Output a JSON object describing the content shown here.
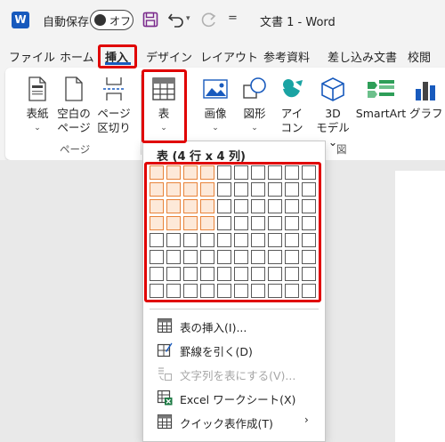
{
  "titlebar": {
    "autosave_label": "自動保存",
    "toggle_state": "オフ",
    "document_title": "文書 1  -  Word",
    "word_logo": "W",
    "qat_customize": "="
  },
  "tabs": [
    "ファイル",
    "ホーム",
    "挿入",
    "デザイン",
    "レイアウト",
    "参考資料",
    "差し込み文書",
    "校閲"
  ],
  "ribbon": {
    "cover": [
      "表紙",
      "⌄"
    ],
    "blank_page": [
      "空白の",
      "ページ"
    ],
    "page_break": [
      "ページ",
      "区切り"
    ],
    "table": [
      "表",
      "⌄"
    ],
    "picture": [
      "画像",
      "⌄"
    ],
    "shapes": [
      "図形",
      "⌄"
    ],
    "icons": [
      "アイ",
      "コン"
    ],
    "model3d": [
      "3D",
      "モデル ⌄"
    ],
    "smartart": "SmartArt",
    "chart": "グラフ",
    "group_pages": "ページ",
    "group_illustrations": "図"
  },
  "table_menu": {
    "header": "表 (4 行 x 4 列)",
    "grid_columns": 10,
    "grid_rows": 8,
    "selected_rows": 4,
    "selected_cols": 4,
    "items": [
      {
        "label": "表の挿入(I)...",
        "disabled": false
      },
      {
        "label": "罫線を引く(D)",
        "disabled": false
      },
      {
        "label": "文字列を表にする(V)...",
        "disabled": true
      },
      {
        "label": "Excel ワークシート(X)",
        "disabled": false
      },
      {
        "label": "クイック表作成(T)",
        "disabled": false
      }
    ],
    "submenu_arrow": "›"
  },
  "colors": {
    "highlight_red": "#e00000",
    "word_blue": "#185abd",
    "selected_cell_border": "#e8833a",
    "selected_cell_fill": "#fde9d9"
  }
}
